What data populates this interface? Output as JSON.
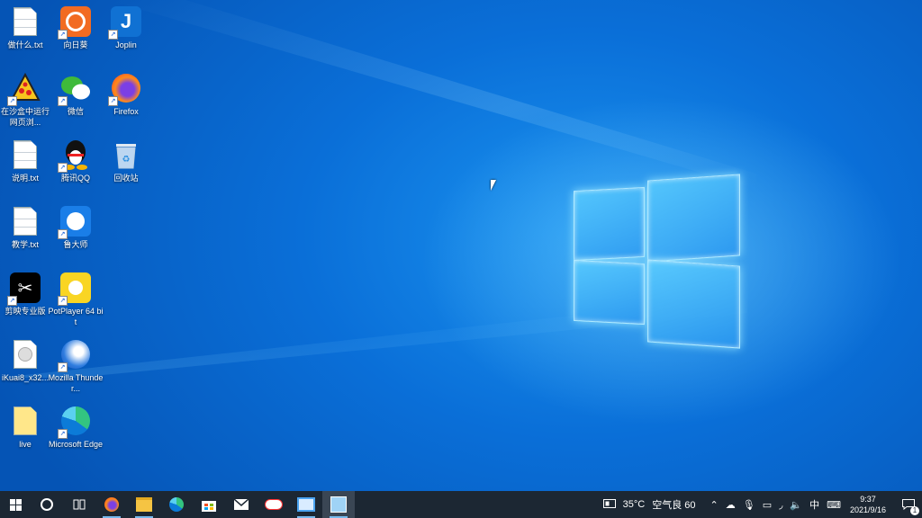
{
  "desktop": {
    "icons": [
      {
        "label": "做什么.txt"
      },
      {
        "label": "向日葵"
      },
      {
        "label": "Joplin"
      },
      {
        "label": "在沙盒中运行网页浏..."
      },
      {
        "label": "微信"
      },
      {
        "label": "Firefox"
      },
      {
        "label": "说明.txt"
      },
      {
        "label": "腾讯QQ"
      },
      {
        "label": "回收站"
      },
      {
        "label": "教学.txt"
      },
      {
        "label": "鲁大师"
      },
      {
        "label": "剪映专业版"
      },
      {
        "label": "PotPlayer 64 bit"
      },
      {
        "label": "iKuai8_x32..."
      },
      {
        "label": "Mozilla Thunder..."
      },
      {
        "label": "live"
      },
      {
        "label": "Microsoft Edge"
      }
    ]
  },
  "taskbar": {
    "start_icon": "windows-start-icon",
    "apps": [
      {
        "name": "search-circle-icon"
      },
      {
        "name": "task-view-icon"
      },
      {
        "name": "firefox-icon"
      },
      {
        "name": "file-explorer-icon"
      },
      {
        "name": "edge-icon"
      },
      {
        "name": "store-icon"
      },
      {
        "name": "mail-icon"
      },
      {
        "name": "cloud-app-icon"
      },
      {
        "name": "monitor-app-icon"
      },
      {
        "name": "remote-app-icon"
      }
    ],
    "weather_temp": "35°C",
    "air_quality": "空气良 60",
    "ime": "中",
    "time": "9:37",
    "date": "2021/9/16",
    "notification_count": "1"
  },
  "colors": {
    "taskbar": "#1c2733",
    "accent": "#0a6fd8"
  }
}
